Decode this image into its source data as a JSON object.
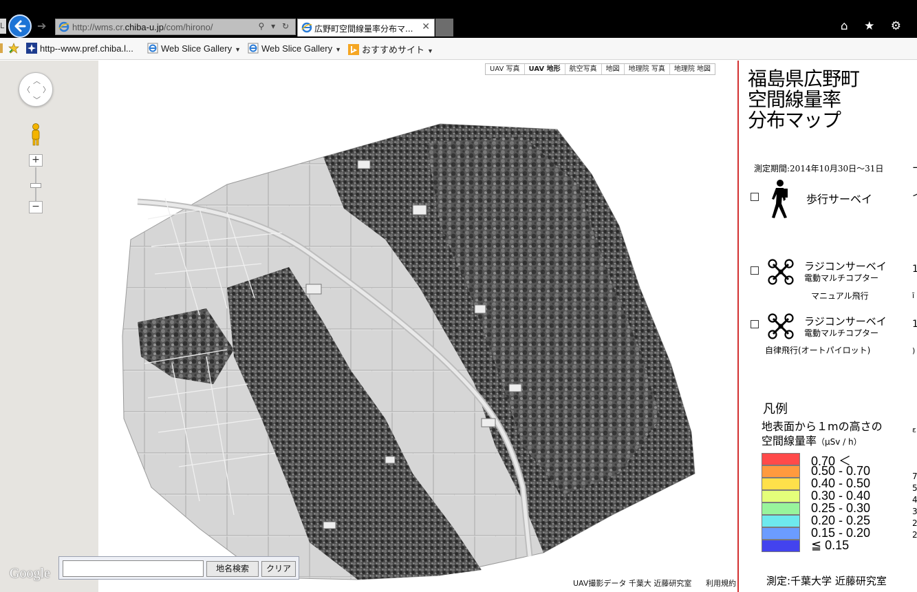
{
  "browser": {
    "tab_stub": "L",
    "address_prefix": "http://wms.cr.",
    "address_host": "chiba-u.jp",
    "address_path": "/com/hirono/",
    "address_tools": "⚲ ▾ ↻",
    "tab_title": "広野町空間線量率分布マ...",
    "tab_close": "✕",
    "right_icons": "⌂ ★ ⚙",
    "favorites": [
      {
        "label": "http--www.pref.chiba.l...",
        "icon": "star-icon"
      },
      {
        "label": "Web Slice Gallery",
        "icon": "ie-icon"
      },
      {
        "label": "Web Slice Gallery",
        "icon": "ie-icon"
      },
      {
        "label": "おすすめサイト",
        "icon": "bing-icon"
      }
    ]
  },
  "map": {
    "map_types": [
      "UAV 写真",
      "UAV 地形",
      "航空写真",
      "地図",
      "地理院 写真",
      "地理院 地図"
    ],
    "google_logo": "Google",
    "search_placeholder": "",
    "geo_search_label": "地名検索",
    "clear_label": "クリア",
    "attribution": "UAV撮影データ 千葉大 近藤研究室",
    "terms": "利用規約",
    "zoom_in": "+",
    "zoom_out": "−"
  },
  "sidebar": {
    "title_lines": [
      "福島県広野町",
      "空間線量率",
      "分布マップ"
    ],
    "period": "測定期間:2014年10月30日〜31日",
    "walk_label": "歩行サーベイ",
    "rc1_label": "ラジコンサーベイ",
    "rc1_sub": "電動マルチコプター",
    "rc1_mode": "マニュアル飛行",
    "rc2_label": "ラジコンサーベイ",
    "rc2_sub": "電動マルチコプター",
    "rc2_mode": "自律飛行(オートパイロット)",
    "legend_title": "凡例",
    "legend_sub1": "地表面から１mの高さの",
    "legend_sub2": "空間線量率",
    "legend_unit": "（μSv / h）",
    "legend": [
      {
        "label": "0.70 ＜",
        "color": "#ff4a4a"
      },
      {
        "label": "0.50 - 0.70",
        "color": "#ff9a3e"
      },
      {
        "label": "0.40 - 0.50",
        "color": "#ffe04a"
      },
      {
        "label": "0.30 - 0.40",
        "color": "#e4ff7a"
      },
      {
        "label": "0.25 - 0.30",
        "color": "#98f49c"
      },
      {
        "label": "0.20 - 0.25",
        "color": "#6ee9ee"
      },
      {
        "label": "0.15 - 0.20",
        "color": "#6b9cff"
      },
      {
        "label": "≦ 0.15",
        "color": "#4343ee"
      }
    ],
    "credit": "測定:千葉大学 近藤研究室"
  }
}
